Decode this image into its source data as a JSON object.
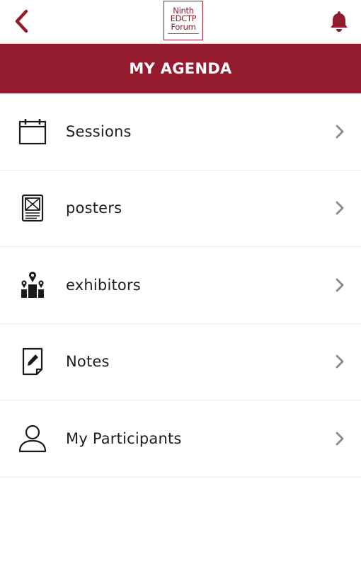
{
  "header": {
    "logo_lines": [
      "Ninth",
      "EDCTP",
      "Forum"
    ],
    "accent_color": "#941b2e"
  },
  "banner": {
    "title": "MY AGENDA"
  },
  "menu": {
    "items": [
      {
        "label": "Sessions",
        "icon": "calendar-icon"
      },
      {
        "label": "posters",
        "icon": "poster-icon"
      },
      {
        "label": "exhibitors",
        "icon": "exhibitors-icon"
      },
      {
        "label": "Notes",
        "icon": "notes-icon"
      },
      {
        "label": "My Participants",
        "icon": "person-icon"
      }
    ]
  }
}
